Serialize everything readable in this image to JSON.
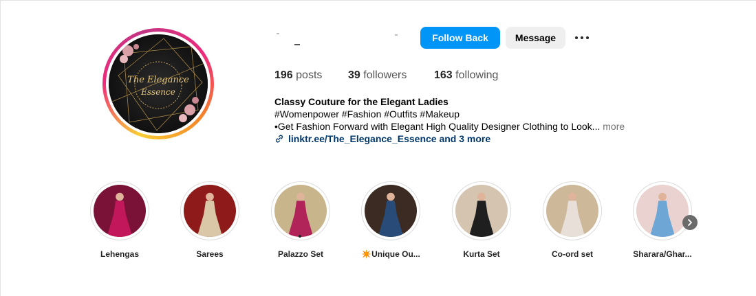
{
  "profile": {
    "posts_count": "196",
    "posts_label": "posts",
    "followers_count": "39",
    "followers_label": "followers",
    "following_count": "163",
    "following_label": "following",
    "avatar_text_line1": "The Elegance",
    "avatar_text_line2": "Essence"
  },
  "actions": {
    "follow_back": "Follow Back",
    "message": "Message"
  },
  "bio": {
    "name": "Classy Couture for the Elegant Ladies",
    "tags": "#Womenpower #Fashion #Outfits #Makeup",
    "line3": "•Get Fashion Forward with Elegant High Quality Designer Clothing to Look...",
    "more": "more",
    "link": "linktr.ee/The_Elegance_Essence and 3 more"
  },
  "highlights": [
    {
      "label": "Lehengas",
      "bg": "#7a1238",
      "dress": "#c2185b"
    },
    {
      "label": "Sarees",
      "bg": "#8e1a1a",
      "dress": "#d9c7a8"
    },
    {
      "label": "Palazzo Set",
      "bg": "#c9b58c",
      "dress": "#b0245a"
    },
    {
      "label": "✴️Unique Ou...",
      "bg": "#3b2b22",
      "dress": "#284b78"
    },
    {
      "label": "Kurta Set",
      "bg": "#d4c4b0",
      "dress": "#1f1f1f"
    },
    {
      "label": "Co-ord set",
      "bg": "#cdb89a",
      "dress": "#e8e0d8"
    },
    {
      "label": "Sharara/Ghar...",
      "bg": "#e9d2cf",
      "dress": "#6ea7d6"
    }
  ],
  "colors": {
    "accent": "#0095f6",
    "link": "#00376b"
  }
}
